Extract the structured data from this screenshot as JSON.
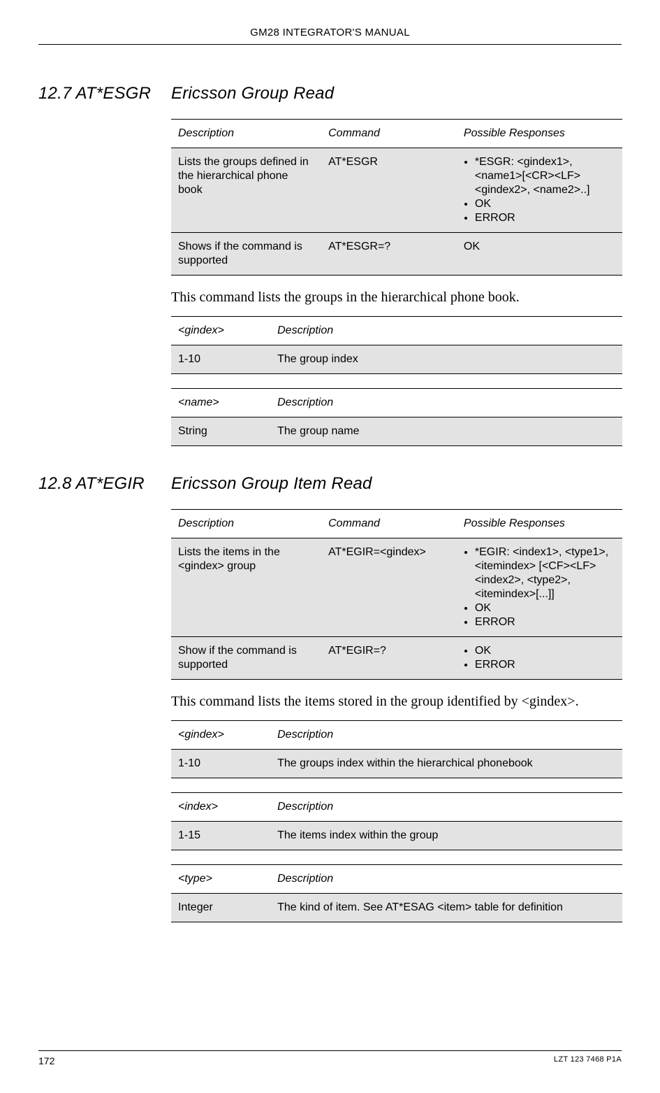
{
  "header": {
    "title": "GM28 INTEGRATOR'S MANUAL"
  },
  "footer": {
    "page_num": "172",
    "doc_id": "LZT 123 7468 P1A"
  },
  "s127": {
    "num": "12.7 AT*ESGR",
    "title": "Ericsson Group Read",
    "cmd_table": {
      "h1": "Description",
      "h2": "Command",
      "h3": "Possible Responses",
      "r1": {
        "desc": "Lists the groups defined in the hierarchical phone book",
        "cmd": "AT*ESGR",
        "resp": [
          "*ESGR: <gindex1>, <name1>[<CR><LF><gindex2>, <name2>..]",
          "OK",
          "ERROR"
        ]
      },
      "r2": {
        "desc": "Shows if the command is supported",
        "cmd": "AT*ESGR=?",
        "resp_text": "OK"
      }
    },
    "body": "This command lists the groups in the hierarchical phone book.",
    "p1": {
      "h1": "<gindex>",
      "h2": "Description",
      "k": "1-10",
      "v": "The group index"
    },
    "p2": {
      "h1": "<name>",
      "h2": "Description",
      "k": "String",
      "v": "The group name"
    }
  },
  "s128": {
    "num": "12.8 AT*EGIR",
    "title": "Ericsson Group Item Read",
    "cmd_table": {
      "h1": "Description",
      "h2": "Command",
      "h3": "Possible Responses",
      "r1": {
        "desc": "Lists the items in the <gindex> group",
        "cmd": "AT*EGIR=<gindex>",
        "resp": [
          "*EGIR: <index1>, <type1>,<itemindex> [<CF><LF><index2>, <type2>, <itemindex>[...]]",
          "OK",
          "ERROR"
        ]
      },
      "r2": {
        "desc": "Show if the command is supported",
        "cmd": "AT*EGIR=?",
        "resp": [
          "OK",
          "ERROR"
        ]
      }
    },
    "body": "This command lists the items stored in the group identified by <gindex>.",
    "p1": {
      "h1": "<gindex>",
      "h2": "Description",
      "k": "1-10",
      "v": "The groups index within the hierarchical phonebook"
    },
    "p2": {
      "h1": "<index>",
      "h2": "Description",
      "k": "1-15",
      "v": "The items index within the group"
    },
    "p3": {
      "h1": "<type>",
      "h2": "Description",
      "k": "Integer",
      "v": "The kind of item. See AT*ESAG <item> table for definition"
    }
  }
}
